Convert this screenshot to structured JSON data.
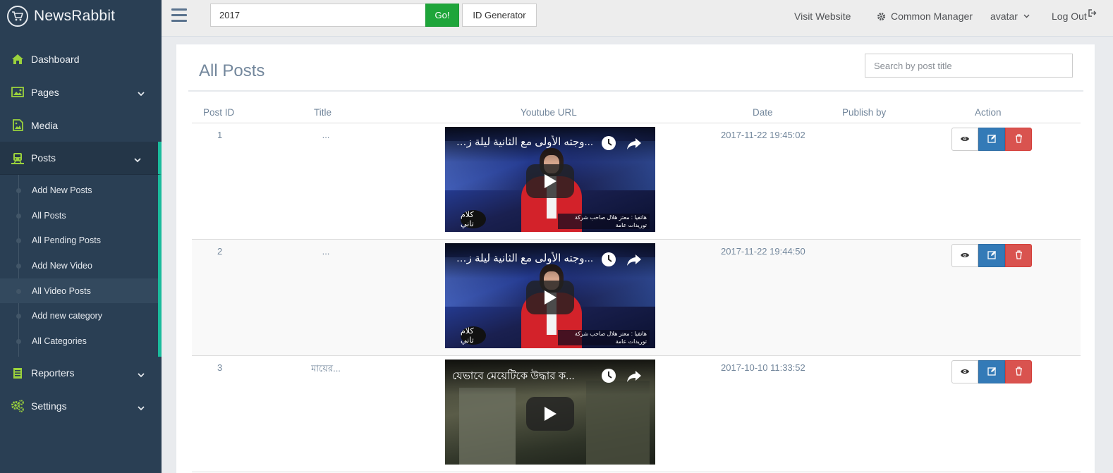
{
  "brand": {
    "title": "NewsRabbit",
    "icon": "cart-icon"
  },
  "sidebar": {
    "items": [
      {
        "label": "Dashboard",
        "icon": "home-icon"
      },
      {
        "label": "Pages",
        "icon": "image-icon"
      },
      {
        "label": "Media",
        "icon": "media-file-icon"
      },
      {
        "label": "Posts",
        "icon": "train-icon"
      },
      {
        "label": "Reporters",
        "icon": "ledger-icon"
      },
      {
        "label": "Settings",
        "icon": "cogs-icon"
      }
    ],
    "posts_submenu": [
      "Add New Posts",
      "All Posts",
      "All Pending Posts",
      "Add New Video",
      "All Video Posts",
      "Add new category",
      "All Categories"
    ],
    "current_submenu": "All Video Posts"
  },
  "topbar": {
    "search_value": "2017",
    "go_label": "Go!",
    "id_generator_label": "ID Generator",
    "visit_website": "Visit Website",
    "common_manager": "Common Manager",
    "user": "avatar",
    "logout": "Log Out"
  },
  "main": {
    "title": "All Posts",
    "search_placeholder": "Search by post title",
    "columns": [
      "Post ID",
      "Title",
      "Youtube URL",
      "Date",
      "Publish by",
      "Action"
    ],
    "rows": [
      {
        "id": "1",
        "title": "...",
        "video_title": "...وجته الأولى مع الثانية ليلة زفافه",
        "date": "2017-11-22 19:45:02",
        "publish_by": ""
      },
      {
        "id": "2",
        "title": "...",
        "video_title": "...وجته الأولى مع الثانية ليلة زفافه",
        "date": "2017-11-22 19:44:50",
        "publish_by": ""
      },
      {
        "id": "3",
        "title": "মায়ের...",
        "video_title": "যেভাবে মেয়েটিকে উদ্ধার ক...",
        "date": "2017-10-10 11:33:52",
        "publish_by": ""
      }
    ],
    "video_logo_text": "كلام تاني",
    "video_caption": "هاتفيا : معتز هلال صاحب شركة توريدات عامة"
  },
  "colors": {
    "sidebar_bg": "#2a3f54",
    "accent": "#1abb9c",
    "icon_green": "#9bd23c",
    "go_green": "#1ea53a",
    "edit_blue": "#337ab7",
    "delete_red": "#d9534f"
  }
}
